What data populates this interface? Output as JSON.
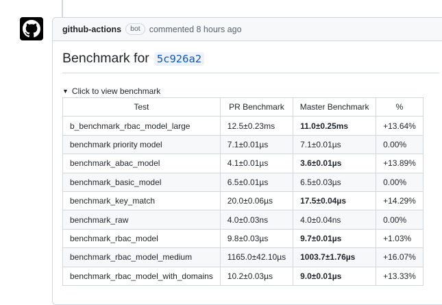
{
  "comment": {
    "author": "github-actions",
    "badge": "bot",
    "meta": "commented 8 hours ago"
  },
  "heading": {
    "prefix": "Benchmark for",
    "sha": "5c926a2"
  },
  "details": {
    "summary": "Click to view benchmark"
  },
  "table": {
    "headers": [
      "Test",
      "PR Benchmark",
      "Master Benchmark",
      "%"
    ],
    "rows": [
      [
        "b_benchmark_rbac_model_large",
        "12.5±0.23ms",
        "11.0±0.25ms",
        "+13.64%"
      ],
      [
        "benchmark priority model",
        "7.1±0.01µs",
        "7.1±0.01µs",
        "0.00%"
      ],
      [
        "benchmark_abac_model",
        "4.1±0.01µs",
        "3.6±0.01µs",
        "+13.89%"
      ],
      [
        "benchmark_basic_model",
        "6.5±0.01µs",
        "6.5±0.03µs",
        "0.00%"
      ],
      [
        "benchmark_key_match",
        "20.0±0.06µs",
        "17.5±0.04µs",
        "+14.29%"
      ],
      [
        "benchmark_raw",
        "4.0±0.03ns",
        "4.0±0.04ns",
        "0.00%"
      ],
      [
        "benchmark_rbac_model",
        "9.8±0.03µs",
        "9.7±0.01µs",
        "+1.03%"
      ],
      [
        "benchmark_rbac_model_medium",
        "1165.0±42.10µs",
        "1003.7±1.76µs",
        "+16.07%"
      ],
      [
        "benchmark_rbac_model_with_domains",
        "10.2±0.03µs",
        "9.0±0.01µs",
        "+13.33%"
      ]
    ],
    "bold_master_rows": [
      0,
      2,
      4,
      6,
      7,
      8
    ]
  }
}
